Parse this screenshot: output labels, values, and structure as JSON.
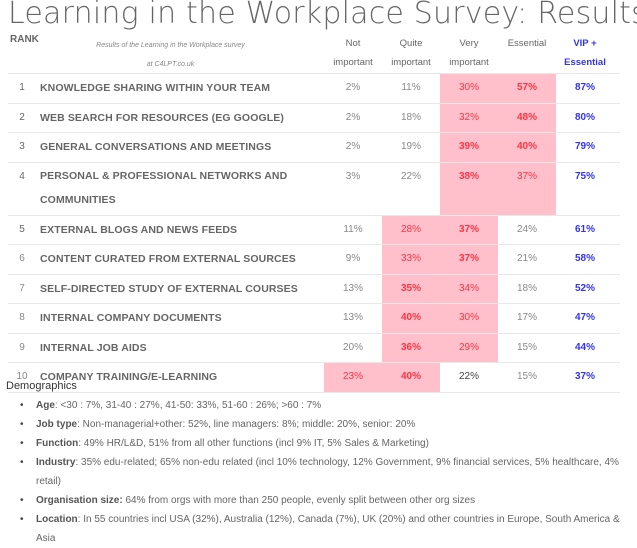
{
  "title": "Learning in the Workplace Survey: Results",
  "header": {
    "rank": "RANK",
    "subtitle_line1": "Results of the Learning in the Workplace survey",
    "subtitle_line2": "at C4LPT.co.uk",
    "columns": [
      {
        "line1": "Not",
        "line2": "important"
      },
      {
        "line1": "Quite",
        "line2": "important"
      },
      {
        "line1": "Very",
        "line2": "important"
      },
      {
        "line1": "Essential",
        "line2": ""
      },
      {
        "line1": "VIP +",
        "line2": "Essential"
      }
    ]
  },
  "colors": {
    "highlight_bg": "#ffc0cb",
    "highlight_text": "#ff3344",
    "vip_text": "#3333ee"
  },
  "rows": [
    {
      "rank": "1",
      "label": "KNOWLEDGE SHARING WITHIN YOUR TEAM",
      "not": "2%",
      "quite": "11%",
      "very": "30%",
      "essential": "57%",
      "vip": "87%"
    },
    {
      "rank": "2",
      "label": "WEB SEARCH FOR RESOURCES (EG GOOGLE)",
      "not": "2%",
      "quite": "18%",
      "very": "32%",
      "essential": "48%",
      "vip": "80%"
    },
    {
      "rank": "3",
      "label": "GENERAL CONVERSATIONS AND MEETINGS",
      "not": "2%",
      "quite": "19%",
      "very": "39%",
      "essential": "40%",
      "vip": "79%"
    },
    {
      "rank": "4",
      "label_line1": "PERSONAL & PROFESSIONAL NETWORKS AND",
      "label_line2": "COMMUNITIES",
      "not": "3%",
      "quite": "22%",
      "very": "38%",
      "essential": "37%",
      "vip": "75%"
    },
    {
      "rank": "5",
      "label": "EXTERNAL BLOGS AND NEWS FEEDS",
      "not": "11%",
      "quite": "28%",
      "very": "37%",
      "essential": "24%",
      "vip": "61%"
    },
    {
      "rank": "6",
      "label": "CONTENT CURATED FROM EXTERNAL SOURCES",
      "not": "9%",
      "quite": "33%",
      "very": "37%",
      "essential": "21%",
      "vip": "58%"
    },
    {
      "rank": "7",
      "label": "SELF-DIRECTED STUDY OF EXTERNAL COURSES",
      "not": "13%",
      "quite": "35%",
      "very": "34%",
      "essential": "18%",
      "vip": "52%"
    },
    {
      "rank": "8",
      "label": "INTERNAL COMPANY DOCUMENTS",
      "not": "13%",
      "quite": "40%",
      "very": "30%",
      "essential": "17%",
      "vip": "47%"
    },
    {
      "rank": "9",
      "label": "INTERNAL JOB AIDS",
      "not": "20%",
      "quite": "36%",
      "very": "29%",
      "essential": "15%",
      "vip": "44%"
    },
    {
      "rank": "10",
      "label": "COMPANY TRAINING/E-LEARNING",
      "not": "23%",
      "quite": "40%",
      "very": "22%",
      "essential": "15%",
      "vip": "37%"
    }
  ],
  "demographics": {
    "heading": "Demographics",
    "items": [
      {
        "key": "Age",
        "sep": ":",
        "text": " <30 : 7%, 31-40 : 27%,  41-50: 33%, 51-60 : 26%; >60 : 7%"
      },
      {
        "key": "Job type",
        "sep": ":",
        "text": " Non-managerial+other: 52%, line managers: 8%; middle: 20%, senior: 20%"
      },
      {
        "key": "Function",
        "sep": ":",
        "text": " 49% HR/L&D, 51% from all other functions (incl 9% IT, 5% Sales & Marketing)"
      },
      {
        "key": "Industry",
        "sep": ":",
        "text": " 35% edu-related; 65% non-edu related (incl 10% technology, 12% Government, 9% financial services, 5% healthcare, 4% retail)"
      },
      {
        "key": "Organisation size:",
        "sep": "",
        "text": " 64% from orgs with more than 250 people, evenly split between other org sizes"
      },
      {
        "key": "Location",
        "sep": ":",
        "text": " In 55 countries incl USA (32%), Australia (12%), Canada (7%), UK (20%) and other countries in Europe, South America & Asia"
      }
    ]
  }
}
